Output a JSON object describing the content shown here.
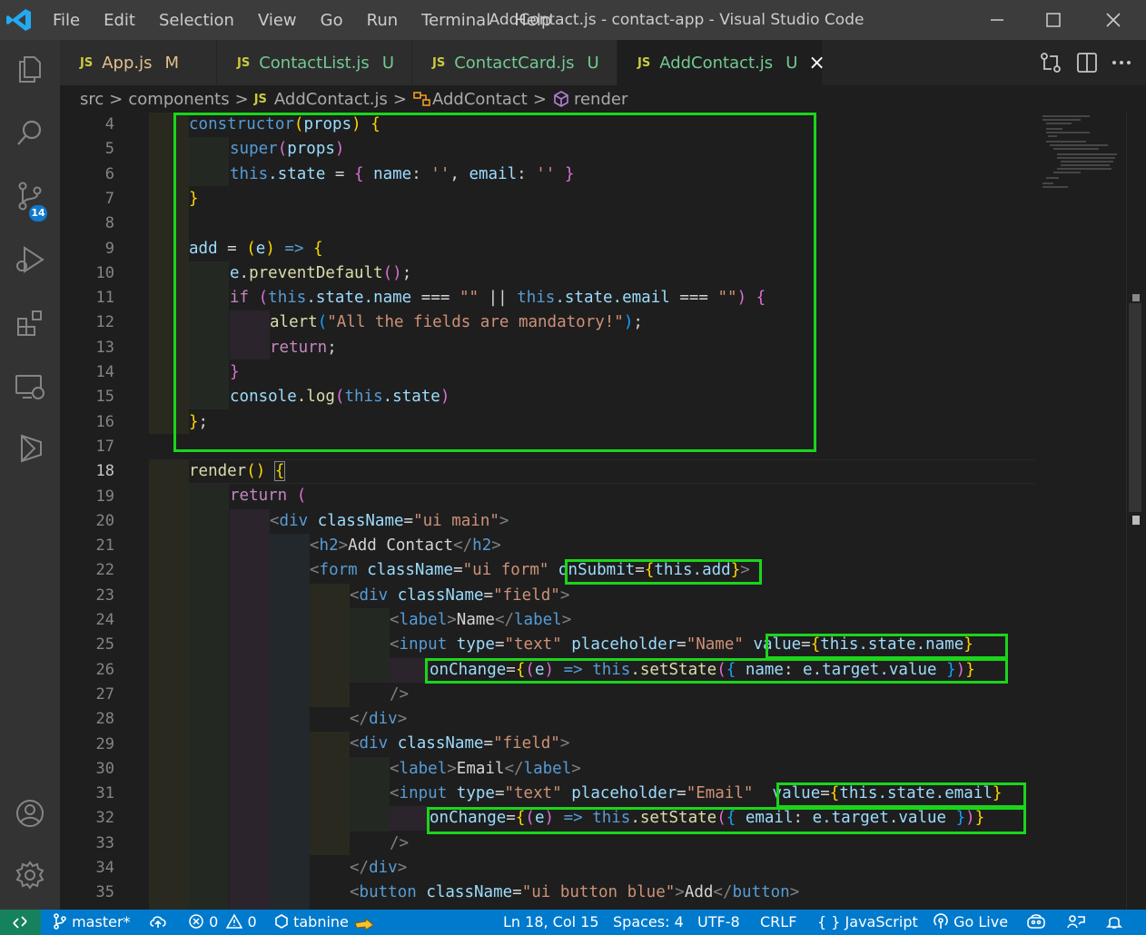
{
  "menu": [
    "File",
    "Edit",
    "Selection",
    "View",
    "Go",
    "Run",
    "Terminal",
    "Help"
  ],
  "window_title": "AddContact.js - contact-app - Visual Studio Code",
  "tabs": [
    {
      "icon": "JS",
      "name": "App.js",
      "status": "M"
    },
    {
      "icon": "JS",
      "name": "ContactList.js",
      "status": "U"
    },
    {
      "icon": "JS",
      "name": "ContactCard.js",
      "status": "U"
    },
    {
      "icon": "JS",
      "name": "AddContact.js",
      "status": "U"
    }
  ],
  "breadcrumb": {
    "folder1": "src",
    "folder2": "components",
    "file_icon": "JS",
    "file": "AddContact.js",
    "class": "AddContact",
    "method": "render",
    "sep": ">"
  },
  "scm_badge": "14",
  "line_numbers": [
    "4",
    "5",
    "6",
    "7",
    "8",
    "9",
    "10",
    "11",
    "12",
    "13",
    "14",
    "15",
    "16",
    "17",
    "18",
    "19",
    "20",
    "21",
    "22",
    "23",
    "24",
    "25",
    "26",
    "27",
    "28",
    "29",
    "30",
    "31",
    "32",
    "33",
    "34",
    "35"
  ],
  "code": {
    "constructor": "constructor",
    "props": "props",
    "super": "super",
    "this": "this",
    "state": ".state",
    "assign": " = ",
    "name_key": "name",
    "email_key": "email",
    "empty_sq": "''",
    "add": "add",
    "e": "e",
    "arrow": "=>",
    "preventDefault": "preventDefault",
    "if": "if",
    "state_name": ".state.name",
    "state_email": ".state.email",
    "seq": "===",
    "or": "||",
    "empty_dq": "\"\"",
    "alert": "alert",
    "alert_msg": "\"All the fields are mandatory!\"",
    "return": "return",
    "console": "console",
    "log": ".log",
    "render": "render",
    "div": "div",
    "className": "className",
    "ui_main": "\"ui main\"",
    "h2": "h2",
    "add_contact_text": "Add Contact",
    "form": "form",
    "ui_form": "\"ui form\"",
    "onSubmit": "onSubmit",
    "this_add": "this.add",
    "field": "\"field\"",
    "label": "label",
    "Name": "Name",
    "Email": "Email",
    "input": "input",
    "type": "type",
    "text": "\"text\"",
    "placeholder": "placeholder",
    "ph_name": "\"Name\"",
    "ph_email": "\"Email\"",
    "value": "value",
    "this_state_name": "this.state.name",
    "this_state_email": "this.state.email",
    "onChange": "onChange",
    "setState": ".setState",
    "target_value": "e.target.value",
    "button": "button",
    "btn_class": "\"ui button blue\"",
    "btn_text": "Add"
  },
  "status": {
    "branch": "master*",
    "errors": "0",
    "warnings": "0",
    "tabnine": "tabnine",
    "position": "Ln 18, Col 15",
    "spaces": "Spaces: 4",
    "encoding": "UTF-8",
    "eol": "CRLF",
    "language_icon": "{ }",
    "language": "JavaScript",
    "golive": "Go Live"
  },
  "colors": {
    "highlight_box": "#1bd51b",
    "status_bar": "#007acc",
    "activity_bar": "#333333",
    "editor_bg": "#1e1e1e"
  }
}
